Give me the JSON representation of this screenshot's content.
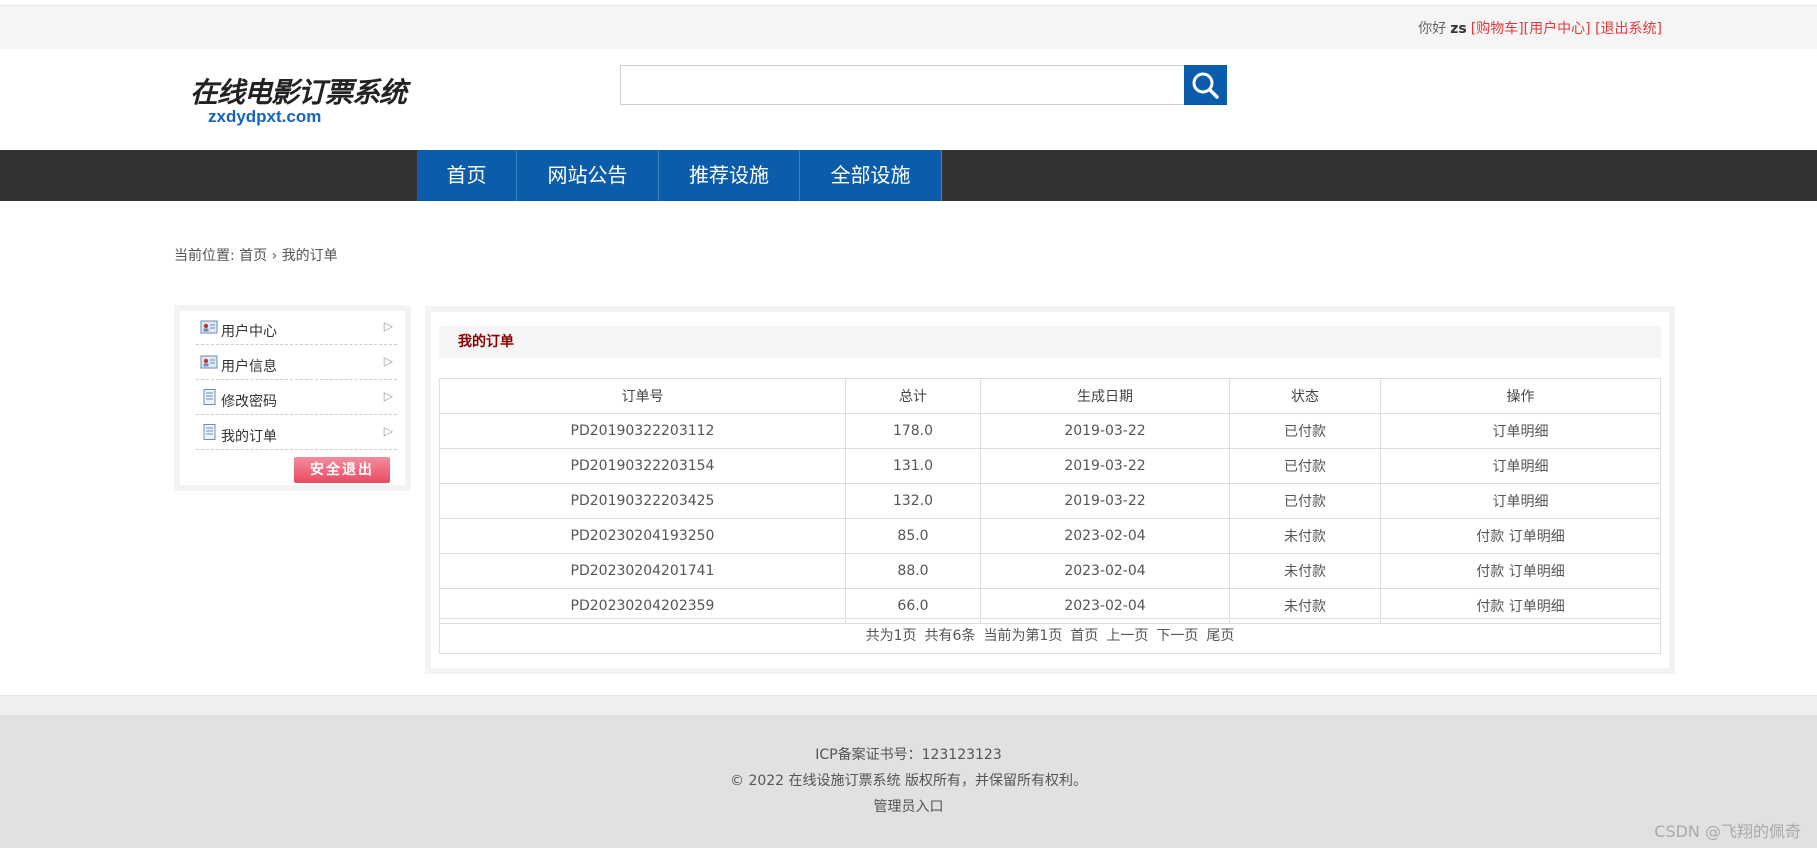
{
  "topbar": {
    "greeting": "你好",
    "username": "zs",
    "cart_link": "[购物车]",
    "usercenter_link": "[用户中心]",
    "logout_link": "[退出系统]"
  },
  "logo": {
    "cn_text": "在线电影订票系统",
    "en_text": "zxdydpxt.com"
  },
  "search": {
    "value": "",
    "placeholder": ""
  },
  "nav": {
    "items": [
      {
        "label": "首页"
      },
      {
        "label": "网站公告"
      },
      {
        "label": "推荐设施"
      },
      {
        "label": "全部设施"
      }
    ]
  },
  "breadcrumb": {
    "prefix": "当前位置: ",
    "home": "首页",
    "separator": "›",
    "current": "我的订单"
  },
  "sidebar": {
    "items": [
      {
        "label": "用户中心",
        "icon": "user-card-icon"
      },
      {
        "label": "用户信息",
        "icon": "user-card-icon"
      },
      {
        "label": "修改密码",
        "icon": "document-icon"
      },
      {
        "label": "我的订单",
        "icon": "document-icon"
      }
    ],
    "logout_label": "安全退出"
  },
  "orders": {
    "title": "我的订单",
    "headers": [
      "订单号",
      "总计",
      "生成日期",
      "状态",
      "操作"
    ],
    "rows": [
      {
        "id": "PD20190322203112",
        "total": "178.0",
        "date": "2019-03-22",
        "status": "已付款",
        "pay": "",
        "detail": "订单明细"
      },
      {
        "id": "PD20190322203154",
        "total": "131.0",
        "date": "2019-03-22",
        "status": "已付款",
        "pay": "",
        "detail": "订单明细"
      },
      {
        "id": "PD20190322203425",
        "total": "132.0",
        "date": "2019-03-22",
        "status": "已付款",
        "pay": "",
        "detail": "订单明细"
      },
      {
        "id": "PD20230204193250",
        "total": "85.0",
        "date": "2023-02-04",
        "status": "未付款",
        "pay": "付款",
        "detail": "订单明细"
      },
      {
        "id": "PD20230204201741",
        "total": "88.0",
        "date": "2023-02-04",
        "status": "未付款",
        "pay": "付款",
        "detail": "订单明细"
      },
      {
        "id": "PD20230204202359",
        "total": "66.0",
        "date": "2023-02-04",
        "status": "未付款",
        "pay": "付款",
        "detail": "订单明细"
      }
    ]
  },
  "pager": {
    "total_pages": "共为1页",
    "total_records": "共有6条",
    "current": "当前为第1页",
    "first": "首页",
    "prev": "上一页",
    "next": "下一页",
    "last": "尾页"
  },
  "footer": {
    "icp": "ICP备案证书号：123123123",
    "copyright": "© 2022 在线设施订票系统 版权所有，并保留所有权利。",
    "admin_link": "管理员入口",
    "watermark": "CSDN @飞翔的佩奇"
  },
  "colors": {
    "brand_blue": "#0b5dab",
    "nav_bg": "#333333",
    "link_red": "#e4393c",
    "title_red": "#8b0000"
  }
}
